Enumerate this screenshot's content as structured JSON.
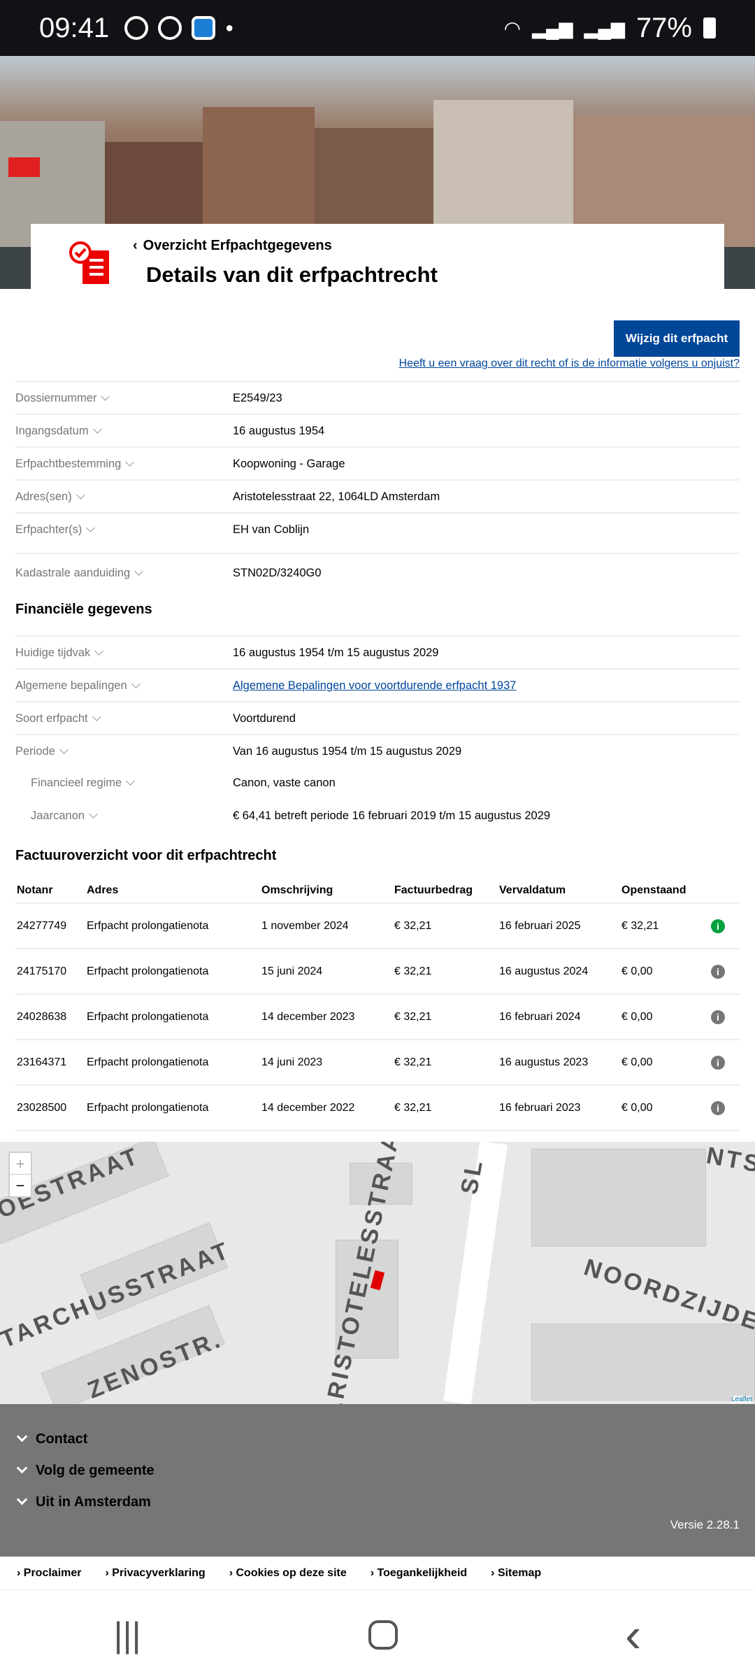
{
  "status_bar": {
    "time": "09:41",
    "battery": "77%"
  },
  "header": {
    "back_label": "Overzicht Erfpachtgegevens",
    "title": "Details van dit erfpachtrecht"
  },
  "actions": {
    "edit_button": "Wijzig dit erfpacht",
    "question_link": "Heeft u een vraag over dit recht of is de informatie volgens u onjuist?"
  },
  "details": [
    {
      "label": "Dossiernummer",
      "value": "E2549/23"
    },
    {
      "label": "Ingangsdatum",
      "value": "16 augustus 1954"
    },
    {
      "label": "Erfpachtbestemming",
      "value": "Koopwoning - Garage"
    },
    {
      "label": "Adres(sen)",
      "value": "Aristotelesstraat 22, 1064LD Amsterdam"
    },
    {
      "label": "Erfpachter(s)",
      "value": "EH van Coblijn"
    },
    {
      "label": "Kadastrale aanduiding",
      "value": "STN02D/3240G0"
    }
  ],
  "financial": {
    "heading": "Financiële gegevens",
    "rows": [
      {
        "label": "Huidige tijdvak",
        "value": "16 augustus 1954 t/m 15 augustus 2029"
      },
      {
        "label": "Algemene bepalingen",
        "value": "Algemene Bepalingen voor voortdurende erfpacht 1937"
      },
      {
        "label": "Soort erfpacht",
        "value": "Voortdurend"
      },
      {
        "label": "Periode",
        "value": "Van 16 augustus 1954 t/m 15 augustus 2029"
      },
      {
        "label": "Financieel regime",
        "value": "Canon, vaste canon"
      },
      {
        "label": "Jaarcanon",
        "value": "€ 64,41 betreft periode 16 februari 2019 t/m 15 augustus 2029"
      }
    ]
  },
  "invoices": {
    "heading": "Factuuroverzicht voor dit erfpachtrecht",
    "columns": [
      "Notanr",
      "Adres",
      "Omschrijving",
      "Factuurbedrag",
      "Vervaldatum",
      "Openstaand"
    ],
    "rows": [
      [
        "24277749",
        "Erfpacht prolongatienota",
        "1 november 2024",
        "€ 32,21",
        "16 februari 2025",
        "€ 32,21"
      ],
      [
        "24175170",
        "Erfpacht prolongatienota",
        "15 juni 2024",
        "€ 32,21",
        "16 augustus 2024",
        "€ 0,00"
      ],
      [
        "24028638",
        "Erfpacht prolongatienota",
        "14 december 2023",
        "€ 32,21",
        "16 februari 2024",
        "€ 0,00"
      ],
      [
        "23164371",
        "Erfpacht prolongatienota",
        "14 juni 2023",
        "€ 32,21",
        "16 augustus 2023",
        "€ 0,00"
      ],
      [
        "23028500",
        "Erfpacht prolongatienota",
        "14 december 2022",
        "€ 32,21",
        "16 februari 2023",
        "€ 0,00"
      ]
    ],
    "info_icon": "i"
  },
  "map": {
    "zoom_in": "+",
    "zoom_out": "−",
    "streets": [
      "OESTRAAT",
      "TARCHUSSTRAAT",
      "ZENOSTR.",
      "ARISTOTELESSTRAAT",
      "SL",
      "NOORDZIJDE",
      "NTSO"
    ],
    "attribution": "Leaflet"
  },
  "footer": {
    "items": [
      "Contact",
      "Volg de gemeente",
      "Uit in Amsterdam"
    ],
    "version": "Versie 2.28.1",
    "links": [
      "Proclaimer",
      "Privacyverklaring",
      "Cookies op deze site",
      "Toegankelijkheid",
      "Sitemap"
    ]
  },
  "nav": {
    "recent": "|||",
    "home": "○",
    "back": "‹"
  },
  "colors": {
    "primary": "#004699",
    "red": "#ec0000",
    "footer": "#767676",
    "green": "#00a03c"
  }
}
